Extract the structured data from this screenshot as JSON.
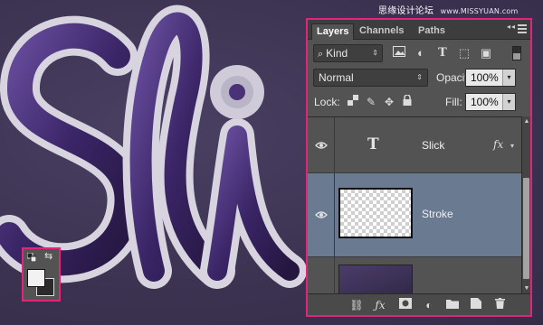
{
  "watermark": {
    "text": "思缘设计论坛",
    "url": "www.MISSYUAN.com"
  },
  "canvas": {
    "artwork_text": "Slick",
    "colors": {
      "background": "#3f3656",
      "letter_fill": "#3d2a63",
      "letter_stroke": "#d9d6e2"
    }
  },
  "color_swatches": {
    "foreground": "#f2f2f2",
    "background": "#2b2b2b"
  },
  "layers_panel": {
    "tabs": [
      {
        "label": "Layers",
        "active": true
      },
      {
        "label": "Channels",
        "active": false
      },
      {
        "label": "Paths",
        "active": false
      }
    ],
    "filter": {
      "kind_label": "Kind",
      "icons": [
        "pixel-filter-icon",
        "adjustment-filter-icon",
        "type-filter-icon",
        "shape-filter-icon",
        "smart-object-filter-icon"
      ]
    },
    "blend_mode": "Normal",
    "opacity_label": "Opacity:",
    "opacity_value": "100%",
    "lock_label": "Lock:",
    "fill_label": "Fill:",
    "fill_value": "100%",
    "layers": [
      {
        "name": "Slick",
        "type": "text",
        "thumb_glyph": "T",
        "fx": "fx",
        "visible": true,
        "selected": false
      },
      {
        "name": "Stroke",
        "type": "pixel",
        "visible": true,
        "selected": true
      },
      {
        "name": "",
        "type": "pixel",
        "visible": true,
        "selected": false
      }
    ],
    "bottom_icons": [
      "link-layers-icon",
      "add-style-icon",
      "add-mask-icon",
      "new-adjustment-icon",
      "new-group-icon",
      "new-layer-icon",
      "delete-layer-icon"
    ]
  }
}
